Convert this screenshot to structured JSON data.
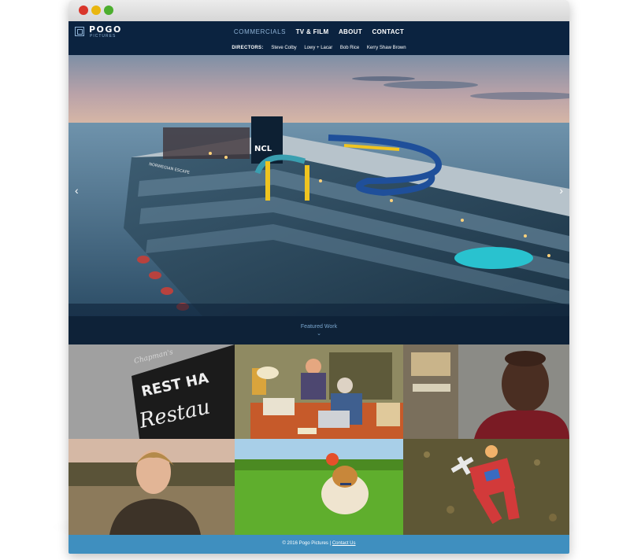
{
  "window": {
    "controls": [
      "close",
      "minimize",
      "maximize"
    ]
  },
  "brand": {
    "name": "POGO",
    "sub": "PICTURES"
  },
  "nav": {
    "items": [
      "COMMERCIALS",
      "TV & FILM",
      "ABOUT",
      "CONTACT"
    ],
    "active": "COMMERCIALS"
  },
  "directors": {
    "label": "DIRECTORS:",
    "names": [
      "Steve Colby",
      "Lowy + Lacar",
      "Bob Rice",
      "Kerry Shaw Brown"
    ]
  },
  "hero": {
    "prev_icon": "chevron-left-icon",
    "next_icon": "chevron-right-icon",
    "ship_logo": "NCL",
    "ship_name": "NORWEGIAN ESCAPE"
  },
  "featured": {
    "label": "Featured Work",
    "icon": "chevron-down-icon",
    "chevron": "⌄"
  },
  "work_tiles": {
    "restaurant_sign_top": "Chapman's",
    "restaurant_sign_main": "REST HA",
    "restaurant_sign_script": "Restau"
  },
  "footer": {
    "copyright": "© 2016 Pogo Pictures |",
    "contact_link": "Contact Us"
  },
  "colors": {
    "header_bg": "#0b2340",
    "accent": "#8fb3d6",
    "footer_bg": "#3f8fbf",
    "featured_bg": "#0e2238"
  }
}
